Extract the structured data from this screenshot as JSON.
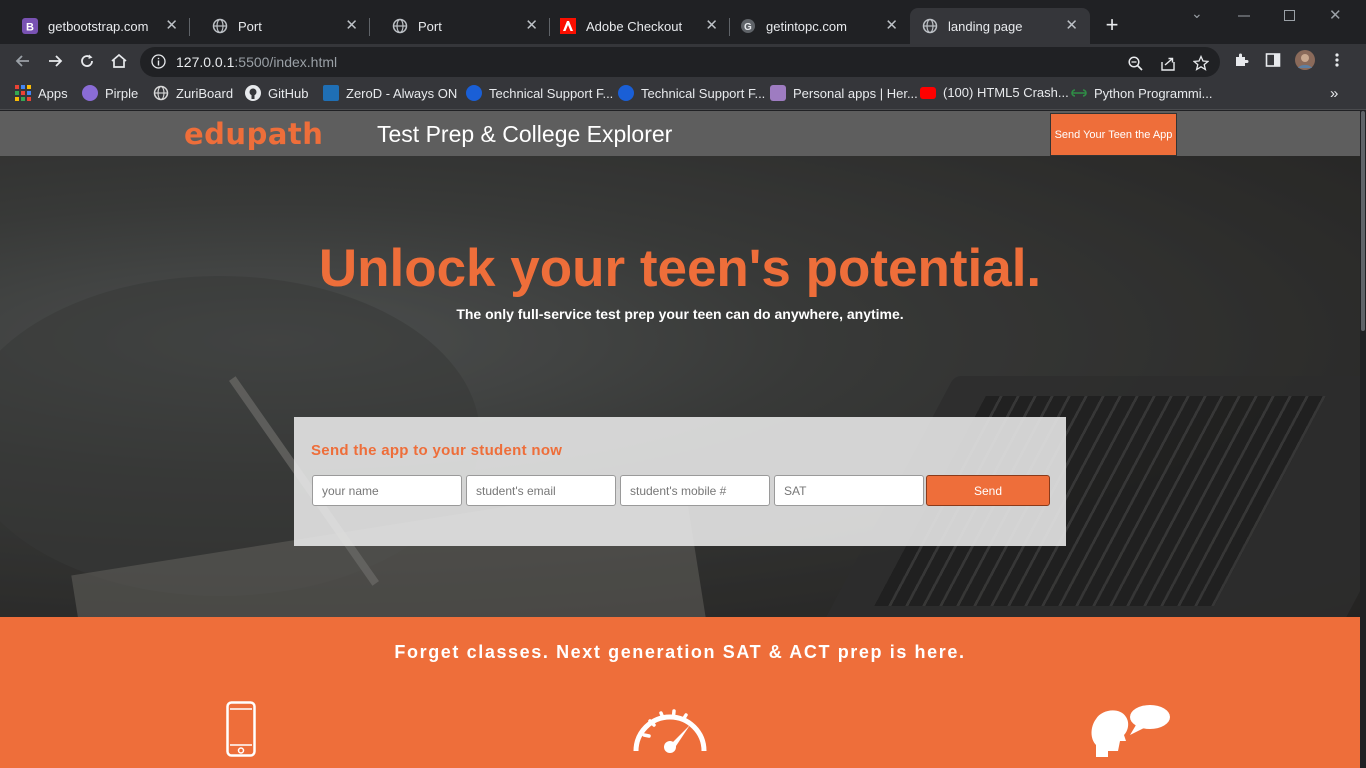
{
  "browser": {
    "tabs": [
      {
        "title": "getbootstrap.com",
        "icon": "bootstrap-icon"
      },
      {
        "title": "Port",
        "icon": "globe-icon"
      },
      {
        "title": "Port",
        "icon": "globe-icon"
      },
      {
        "title": "Adobe Checkout",
        "icon": "adobe-icon"
      },
      {
        "title": "getintopc.com",
        "icon": "g-icon"
      },
      {
        "title": "landing page",
        "icon": "globe-icon",
        "active": true
      }
    ],
    "url_host": "127.0.0.1",
    "url_rest": ":5500/index.html",
    "bookmarks": [
      {
        "label": "Apps",
        "icon": "apps-grid-icon"
      },
      {
        "label": "Pirple",
        "icon": "pirple-icon",
        "color": "#8a6cd6"
      },
      {
        "label": "ZuriBoard",
        "icon": "zuri-icon",
        "color": "#d9d9d9"
      },
      {
        "label": "GitHub",
        "icon": "github-icon",
        "color": "#e8eaed"
      },
      {
        "label": "ZeroD - Always ON",
        "icon": "zerod-icon",
        "color": "#1f6fb5"
      },
      {
        "label": "Technical Support F...",
        "icon": "c-icon",
        "color": "#1a5fd6"
      },
      {
        "label": "Technical Support F...",
        "icon": "c-icon",
        "color": "#1a5fd6"
      },
      {
        "label": "Personal apps | Her...",
        "icon": "heroku-icon",
        "color": "#9e7cc1"
      },
      {
        "label": "(100) HTML5 Crash...",
        "icon": "youtube-icon",
        "color": "#ff0000"
      },
      {
        "label": "Python Programmi...",
        "icon": "gfg-icon",
        "color": "#2f8d46"
      }
    ]
  },
  "site": {
    "logo": "edupath",
    "title": "Test Prep & College Explorer",
    "header_cta": "Send Your Teen the App",
    "hero_title": "Unlock your teen's potential.",
    "hero_subtitle": "The only full-service test prep your teen can do anywhere, anytime.",
    "form": {
      "heading": "Send the app to your student now",
      "name_placeholder": "your name",
      "email_placeholder": "student's email",
      "mobile_placeholder": "student's mobile #",
      "test_placeholder": "SAT",
      "send_label": "Send"
    },
    "features_title": "Forget classes. Next generation SAT & ACT prep is here.",
    "feature_icons": [
      "mobile-phone-icon",
      "speedometer-icon",
      "chat-bubble-icon"
    ]
  },
  "colors": {
    "accent": "#ee6e3a",
    "header_bg": "#5e5e5e"
  }
}
